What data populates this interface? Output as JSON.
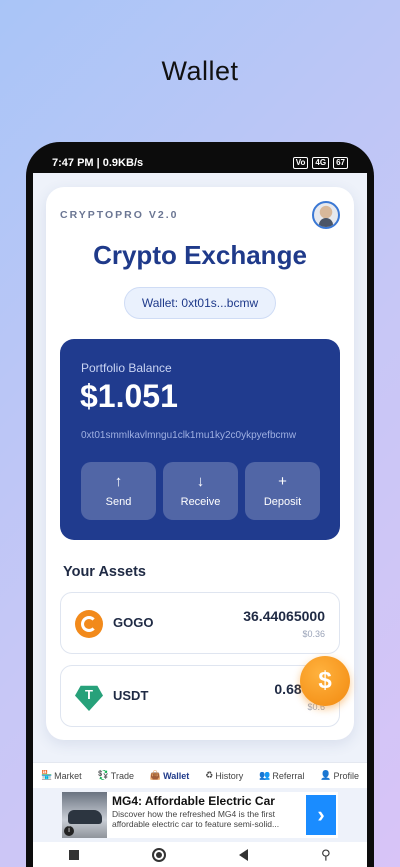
{
  "promo": {
    "title": "Wallet"
  },
  "status_bar": {
    "time_speed": "7:47 PM | 0.9KB/s",
    "volte": "Vo",
    "network": "4G",
    "battery": "67"
  },
  "header": {
    "brand": "CRYPTOPRO V2.0",
    "title": "Crypto Exchange",
    "wallet_pill": "Wallet: 0xt01s...bcmw"
  },
  "portfolio": {
    "label": "Portfolio Balance",
    "amount": "$1.051",
    "address": "0xt01smmlkavlmngu1clk1mu1ky2c0ykpyefbcmw",
    "actions": [
      {
        "icon": "↑",
        "icon_name": "arrow-up-icon",
        "label": "Send"
      },
      {
        "icon": "↓",
        "icon_name": "arrow-down-icon",
        "label": "Receive"
      },
      {
        "icon": "+",
        "icon_name": "plus-icon",
        "label": "Deposit"
      }
    ]
  },
  "assets": {
    "heading": "Your Assets",
    "items": [
      {
        "symbol": "GOGO",
        "amount": "36.44065000",
        "fiat": "$0.36",
        "icon_name": "gogo-coin-icon",
        "color": "#f28a1b"
      },
      {
        "symbol": "USDT",
        "amount": "0.68682",
        "fiat": "$0.6",
        "icon_name": "tether-icon",
        "color": "#27a17a"
      }
    ]
  },
  "fab": {
    "label": "$"
  },
  "bottom_nav": [
    {
      "icon": "🏪",
      "label": "Market"
    },
    {
      "icon": "💱",
      "label": "Trade"
    },
    {
      "icon": "👜",
      "label": "Wallet",
      "active": true
    },
    {
      "icon": "♻",
      "label": "History"
    },
    {
      "icon": "👥",
      "label": "Referral"
    },
    {
      "icon": "👤",
      "label": "Profile"
    }
  ],
  "ad": {
    "title": "MG4: Affordable Electric Car",
    "body": "Discover how the refreshed MG4 is the first affordable electric car to feature semi-solid...",
    "arrow": "›",
    "info": "i"
  },
  "colors": {
    "accent": "#1f3a8a",
    "balance_card": "#203b8e",
    "fab": "#f28a1b"
  }
}
